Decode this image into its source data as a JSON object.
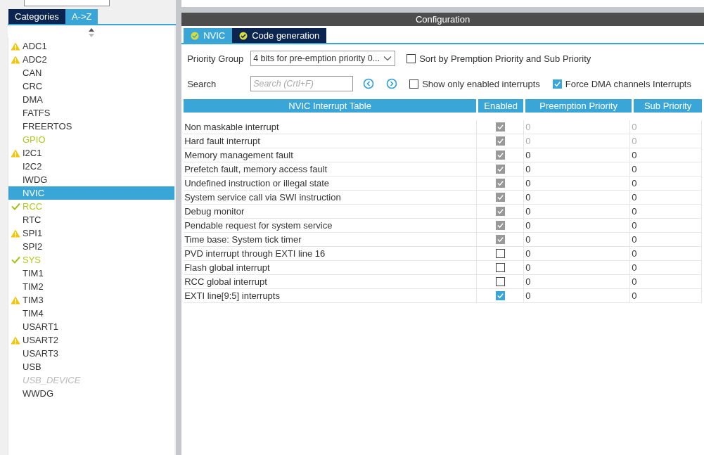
{
  "sidebar": {
    "tabs": [
      {
        "label": "Categories",
        "selected": false
      },
      {
        "label": "A->Z",
        "selected": true
      }
    ],
    "items": [
      {
        "label": "ADC1",
        "warning": true,
        "configured": false,
        "highlighted": false,
        "disabled": false,
        "selected": false
      },
      {
        "label": "ADC2",
        "warning": true,
        "configured": false,
        "highlighted": false,
        "disabled": false,
        "selected": false
      },
      {
        "label": "CAN",
        "warning": false,
        "configured": false,
        "highlighted": false,
        "disabled": false,
        "selected": false
      },
      {
        "label": "CRC",
        "warning": false,
        "configured": false,
        "highlighted": false,
        "disabled": false,
        "selected": false
      },
      {
        "label": "DMA",
        "warning": false,
        "configured": false,
        "highlighted": false,
        "disabled": false,
        "selected": false
      },
      {
        "label": "FATFS",
        "warning": false,
        "configured": false,
        "highlighted": false,
        "disabled": false,
        "selected": false
      },
      {
        "label": "FREERTOS",
        "warning": false,
        "configured": false,
        "highlighted": false,
        "disabled": false,
        "selected": false
      },
      {
        "label": "GPIO",
        "warning": false,
        "configured": false,
        "highlighted": true,
        "disabled": false,
        "selected": false
      },
      {
        "label": "I2C1",
        "warning": true,
        "configured": false,
        "highlighted": false,
        "disabled": false,
        "selected": false
      },
      {
        "label": "I2C2",
        "warning": false,
        "configured": false,
        "highlighted": false,
        "disabled": false,
        "selected": false
      },
      {
        "label": "IWDG",
        "warning": false,
        "configured": false,
        "highlighted": false,
        "disabled": false,
        "selected": false
      },
      {
        "label": "NVIC",
        "warning": false,
        "configured": false,
        "highlighted": false,
        "disabled": false,
        "selected": true
      },
      {
        "label": "RCC",
        "warning": false,
        "configured": true,
        "highlighted": true,
        "disabled": false,
        "selected": false
      },
      {
        "label": "RTC",
        "warning": false,
        "configured": false,
        "highlighted": false,
        "disabled": false,
        "selected": false
      },
      {
        "label": "SPI1",
        "warning": true,
        "configured": false,
        "highlighted": false,
        "disabled": false,
        "selected": false
      },
      {
        "label": "SPI2",
        "warning": false,
        "configured": false,
        "highlighted": false,
        "disabled": false,
        "selected": false
      },
      {
        "label": "SYS",
        "warning": false,
        "configured": true,
        "highlighted": true,
        "disabled": false,
        "selected": false
      },
      {
        "label": "TIM1",
        "warning": false,
        "configured": false,
        "highlighted": false,
        "disabled": false,
        "selected": false
      },
      {
        "label": "TIM2",
        "warning": false,
        "configured": false,
        "highlighted": false,
        "disabled": false,
        "selected": false
      },
      {
        "label": "TIM3",
        "warning": true,
        "configured": false,
        "highlighted": false,
        "disabled": false,
        "selected": false
      },
      {
        "label": "TIM4",
        "warning": false,
        "configured": false,
        "highlighted": false,
        "disabled": false,
        "selected": false
      },
      {
        "label": "USART1",
        "warning": false,
        "configured": false,
        "highlighted": false,
        "disabled": false,
        "selected": false
      },
      {
        "label": "USART2",
        "warning": true,
        "configured": false,
        "highlighted": false,
        "disabled": false,
        "selected": false
      },
      {
        "label": "USART3",
        "warning": false,
        "configured": false,
        "highlighted": false,
        "disabled": false,
        "selected": false
      },
      {
        "label": "USB",
        "warning": false,
        "configured": false,
        "highlighted": false,
        "disabled": false,
        "selected": false
      },
      {
        "label": "USB_DEVICE",
        "warning": false,
        "configured": false,
        "highlighted": false,
        "disabled": true,
        "selected": false
      },
      {
        "label": "WWDG",
        "warning": false,
        "configured": false,
        "highlighted": false,
        "disabled": false,
        "selected": false
      }
    ]
  },
  "configuration": {
    "title": "Configuration",
    "tabs": [
      {
        "label": "NVIC",
        "selected": true
      },
      {
        "label": "Code generation",
        "selected": false
      }
    ],
    "priority_group": {
      "label": "Priority Group",
      "value": "4 bits for pre-emption priority 0..."
    },
    "sort_option": {
      "label": "Sort by Premption Priority and Sub Priority",
      "checked": false
    },
    "search": {
      "label": "Search",
      "placeholder": "Search (Crtl+F)"
    },
    "show_enabled_option": {
      "label": "Show only enabled interrupts",
      "checked": false
    },
    "force_dma_option": {
      "label": "Force DMA channels Interrupts",
      "checked": true
    },
    "table": {
      "columns": [
        "NVIC Interrupt Table",
        "Enabled",
        "Preemption Priority",
        "Sub Priority"
      ],
      "rows": [
        {
          "name": "Non maskable interrupt",
          "enabled": true,
          "locked": true,
          "priorities_locked": true,
          "preemption": "0",
          "sub": "0"
        },
        {
          "name": "Hard fault interrupt",
          "enabled": true,
          "locked": true,
          "priorities_locked": true,
          "preemption": "0",
          "sub": "0"
        },
        {
          "name": "Memory management fault",
          "enabled": true,
          "locked": true,
          "priorities_locked": false,
          "preemption": "0",
          "sub": "0"
        },
        {
          "name": "Prefetch fault, memory access fault",
          "enabled": true,
          "locked": true,
          "priorities_locked": false,
          "preemption": "0",
          "sub": "0"
        },
        {
          "name": "Undefined instruction or illegal state",
          "enabled": true,
          "locked": true,
          "priorities_locked": false,
          "preemption": "0",
          "sub": "0"
        },
        {
          "name": "System service call via SWI instruction",
          "enabled": true,
          "locked": true,
          "priorities_locked": false,
          "preemption": "0",
          "sub": "0"
        },
        {
          "name": "Debug monitor",
          "enabled": true,
          "locked": true,
          "priorities_locked": false,
          "preemption": "0",
          "sub": "0"
        },
        {
          "name": "Pendable request for system service",
          "enabled": true,
          "locked": true,
          "priorities_locked": false,
          "preemption": "0",
          "sub": "0"
        },
        {
          "name": "Time base: System tick timer",
          "enabled": true,
          "locked": true,
          "priorities_locked": false,
          "preemption": "0",
          "sub": "0"
        },
        {
          "name": "PVD interrupt through EXTI line 16",
          "enabled": false,
          "locked": false,
          "priorities_locked": false,
          "preemption": "0",
          "sub": "0"
        },
        {
          "name": "Flash global interrupt",
          "enabled": false,
          "locked": false,
          "priorities_locked": false,
          "preemption": "0",
          "sub": "0"
        },
        {
          "name": "RCC global interrupt",
          "enabled": false,
          "locked": false,
          "priorities_locked": false,
          "preemption": "0",
          "sub": "0"
        },
        {
          "name": "EXTI line[9:5] interrupts",
          "enabled": true,
          "locked": false,
          "priorities_locked": false,
          "preemption": "0",
          "sub": "0"
        }
      ]
    }
  }
}
